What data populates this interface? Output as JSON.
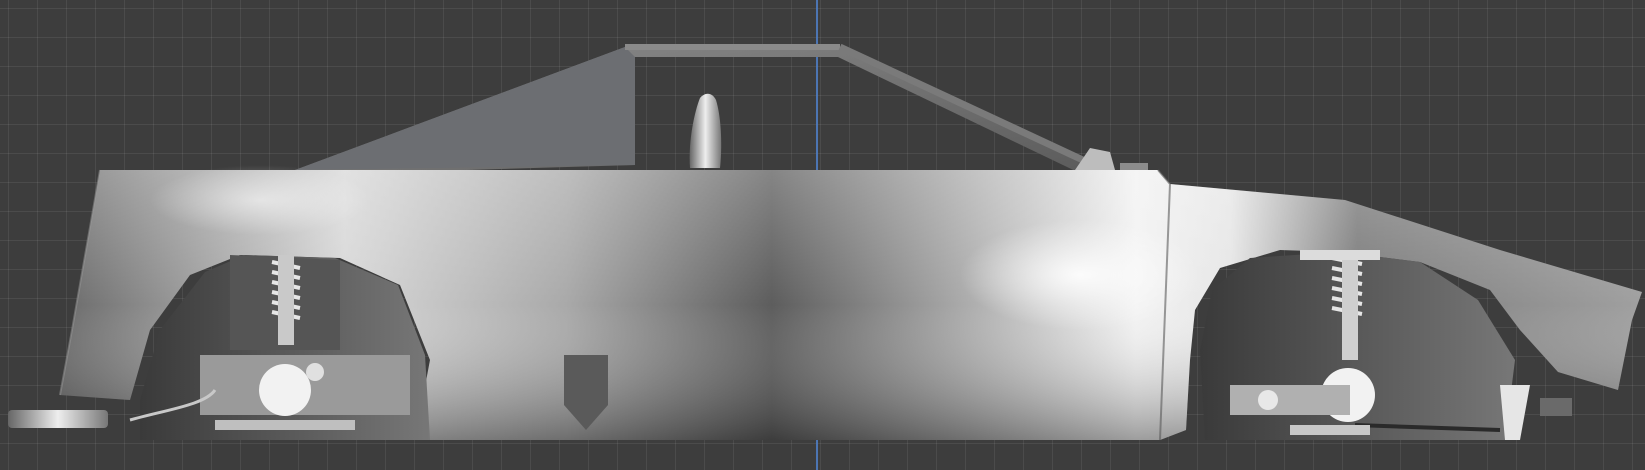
{
  "viewport": {
    "background": "#3d3d3d",
    "grid": true,
    "axis_color": "#4f7fc8",
    "view": "side-orthographic"
  },
  "model": {
    "kind": "car-body-shell",
    "material": "chrome",
    "parts": [
      "body-shell",
      "window-frame",
      "seat",
      "front-suspension",
      "rear-suspension",
      "exhaust-pipe",
      "jack-point"
    ]
  }
}
